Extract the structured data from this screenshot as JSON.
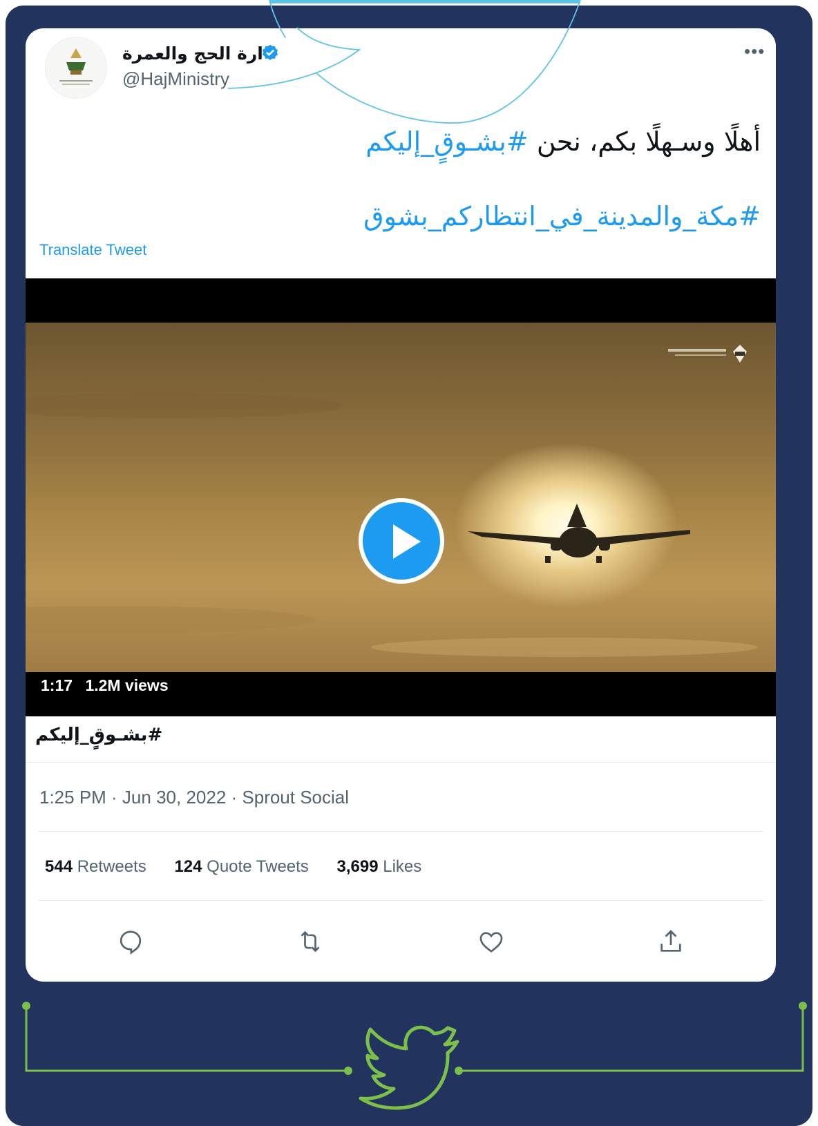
{
  "tweet": {
    "display_name": "وزارة الحج والعمرة",
    "handle": "@HajMinistry",
    "more_label": "•••",
    "text_line1_plain": "أهلًا وسـهلًا بكم، نحن",
    "text_line1_tag": "#بشـوقٍ_إليكم",
    "text_line2_tag": "#مكة_والمدينة_في_انتظاركم_بشوق",
    "translate_label": "Translate Tweet",
    "video_duration": "1:17",
    "video_views": "1.2M views",
    "media_title": "#بشـوقٍ_إليكم",
    "timestamp": "1:25 PM · Jun 30, 2022 · Sprout Social",
    "stats": {
      "retweets_count": "544",
      "retweets_label": "Retweets",
      "quotes_count": "124",
      "quotes_label": "Quote Tweets",
      "likes_count": "3,699",
      "likes_label": "Likes"
    }
  },
  "icons": {
    "verified": "verified-badge-icon",
    "play": "play-icon",
    "reply": "reply-icon",
    "retweet": "retweet-icon",
    "like": "heart-icon",
    "share": "share-icon",
    "bird": "twitter-bird-icon"
  },
  "colors": {
    "frame_bg": "#22335e",
    "accent_blue": "#1d9bf0",
    "deco_cyan": "#5fc3e8",
    "bird_green": "#7cc04b"
  }
}
